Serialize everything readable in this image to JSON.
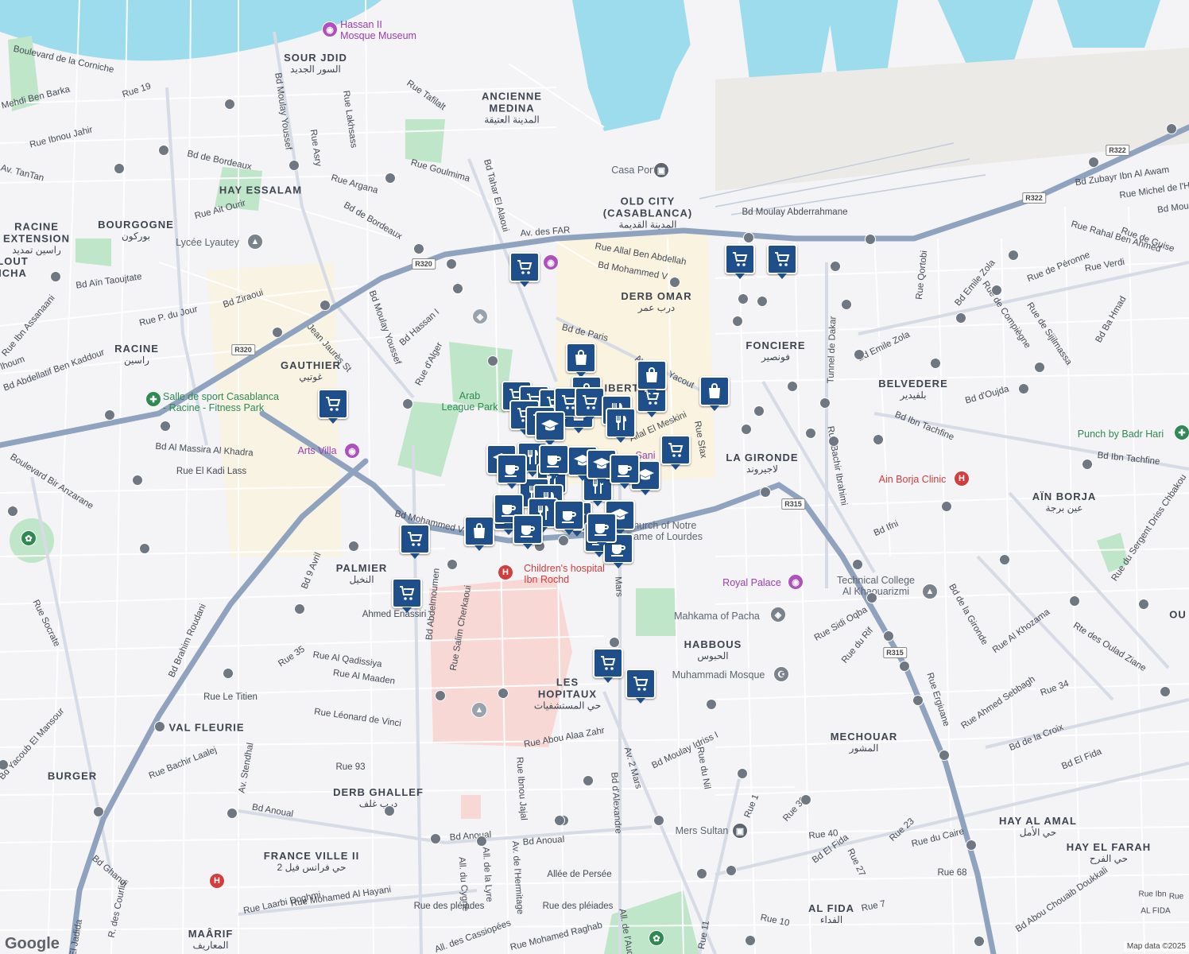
{
  "map": {
    "attribution": "Map data ©2025",
    "logo": "Google",
    "route_shields": [
      "R320",
      "R320",
      "R315",
      "R315",
      "R322",
      "R322"
    ],
    "districts": [
      {
        "name": "SOUR JDID",
        "ar": "السور الجديد"
      },
      {
        "name": "ANCIENNE\nMEDINA",
        "ar": "المدينة العتيقة"
      },
      {
        "name": "OLD CITY\n(CASABLANCA)",
        "ar": "المدينة القديمة"
      },
      {
        "name": "HAY ESSALAM",
        "ar": ""
      },
      {
        "name": "BOURGOGNE",
        "ar": "بوركون"
      },
      {
        "name": "RACINE\nEXTENSION",
        "ar": "راسين تمديد"
      },
      {
        "name": "LOUT\nICHA",
        "ar": ""
      },
      {
        "name": "RACINE",
        "ar": "راسين"
      },
      {
        "name": "GAUTHIER",
        "ar": "غوتيي"
      },
      {
        "name": "DERB OMAR",
        "ar": "درب عمر"
      },
      {
        "name": "FONCIERE",
        "ar": "فونصير"
      },
      {
        "name": "BELVEDERE",
        "ar": "بلفيدير"
      },
      {
        "name": "LIBERT",
        "ar": ""
      },
      {
        "name": "LA GIRONDE",
        "ar": "لاجيروند"
      },
      {
        "name": "AÏN BORJA",
        "ar": "عين برجة"
      },
      {
        "name": "PALMIER",
        "ar": "النخيل"
      },
      {
        "name": "HABBOUS",
        "ar": "الحبوس"
      },
      {
        "name": "LES\nHOPITAUX",
        "ar": "حي المستشفيات"
      },
      {
        "name": "MECHOUAR",
        "ar": "المشور"
      },
      {
        "name": "VAL FLEURIE",
        "ar": ""
      },
      {
        "name": "BURGER",
        "ar": ""
      },
      {
        "name": "DERB GHALLEF",
        "ar": "درب غلف"
      },
      {
        "name": "FRANCE VILLE II",
        "ar": "حي فرانس فيل 2"
      },
      {
        "name": "HAY AL AMAL",
        "ar": "حي الأمل"
      },
      {
        "name": "HAY EL FARAH",
        "ar": "حي الفرح"
      },
      {
        "name": "AL FIDA",
        "ar": "الفداء"
      },
      {
        "name": "MAÂRIF",
        "ar": "المعاريف"
      },
      {
        "name": "OU",
        "ar": ""
      }
    ],
    "streets": [
      "Boulevard de la Corniche",
      "Mehdi Ben Barka",
      "Rue 19",
      "Rue Ibnou Jahir",
      "Bd de Bordeaux",
      "Av. TanTan",
      "Bd Moulay Youssef",
      "Rue Asry",
      "Rue Lakhsass",
      "Rue Tafilalt",
      "Rue Argana",
      "Rue Goulmima",
      "Bd Tahar El Alaoui",
      "Rue Ait Ourir",
      "Bd de Bordeaux",
      "Bd Aïn Taoujtate",
      "Rue P. du Jour",
      "Bd Ziraoui",
      "Rue Ibn Assanaani",
      "Jean Jaurès St",
      "Bd Hassan I",
      "Rue d'Alger",
      "Bd Moulay Youssef",
      "Bd Abdellatif Ben Kaddour",
      "lhoum",
      "Av. des FAR",
      "Rue Allal Ben Abdellah",
      "Bd Mohammed V",
      "Bd de Paris",
      "Av. Lalla Yacout",
      "Bd Moulay Abderrahmane",
      "Tunnel de Dakar",
      "Rue Qortobi",
      "Bd Emile Zola",
      "Rue de Compiègne",
      "Rue de Sijilmassa",
      "Bd Ba Hmad",
      "Rue de Péronne",
      "Rue Verdi",
      "Rue de Guise",
      "Rue Rahal Ben Ahmed",
      "Bd Zubayr Ibn Al Awam",
      "Rue Michel de l'H",
      "Bd Mou",
      "Bd Emile Zola",
      "Bd d'Oujda",
      "Bd Ibn Tachfine",
      "Bd Ibn Tachfine",
      "Rue Bachir Ibrahimi",
      "Rue Sfax",
      "Allal El Meskini",
      "Bd Al Massira Al Khadra",
      "Boulevard Bir Anzarane",
      "Rue El Kadi Lass",
      "Bd Brahim Roudani",
      "Bd Mohammed V",
      "Bd 9 Avril",
      "Rue Socrate",
      "Bd Abdelmoumen",
      "Rue Salim Cherkaoui",
      "Ahmed Enassiri",
      "Bd Ifni",
      "Rue Sidi Oqba",
      "Rue du Rif",
      "Bd de la Gironde",
      "Rue Al Khozama",
      "Rte des Oulad Ziane",
      "Rue du Sergent Driss Chbakou",
      "Rue 35",
      "Rue Al Qadissiya",
      "Rue Al Maaden",
      "Rue Le Titien",
      "Rue Léonard de Vinci",
      "Bd Yacoub El Mansour",
      "Rue Bachir Laalej",
      "Av. Stendhal",
      "Rue 93",
      "Rue Abou Alaa Zahr",
      "Av. 2 Mars",
      "Bd Moulay Idriss I",
      "Rue du Nil",
      "Rue Ergiuane",
      "Rue Ahmed Sebbagh",
      "Rue 34",
      "Bd de la Croix",
      "Bd El Fida",
      "Bd Anoual",
      "Bd Anoual",
      "Bd Anoual",
      "Rue Ibnou Jajal",
      "Av. de l'Hermitage",
      "All. de la Lyre",
      "All. du Cygne",
      "Rue 1",
      "Rue 39",
      "Rue 40",
      "Rue 23",
      "Rue du Caire",
      "Bd El Fida",
      "Rue 27",
      "Rue 68",
      "Rue 7",
      "Rue 10",
      "Bd Abou Chouaib Doukkali",
      "Bd Ghandi",
      "R. des Courlis",
      "Rue Laarbi Doghmi",
      "Rue Mohamed Al Hayani",
      "Rue des pléiades",
      "Rue des pléiades",
      "Allée de Persée",
      "All. des Cassiopées",
      "Rue Mohamed Raghab",
      "All. de l'Aude",
      "Rue 11",
      "Bd d'Alexandre",
      "Mars",
      "El Jadida",
      "AL FIDA",
      "Rue Ibn",
      "Rue"
    ],
    "pois": [
      {
        "label": "Hassan II\nMosque Museum",
        "kind": "museum"
      },
      {
        "label": "Casa Port",
        "kind": "transit"
      },
      {
        "label": "Lycée Lyautey",
        "kind": "school"
      },
      {
        "label": "Arab\nLeague Park",
        "kind": "park"
      },
      {
        "label": "Salle de sport Casablanca\n- Racine - Fitness Park",
        "kind": "gym"
      },
      {
        "label": "Arts Villa",
        "kind": "museum"
      },
      {
        "label": "Children's hospital\nIbn Rochd",
        "kind": "hospital"
      },
      {
        "label": "Church of Notre\nDame of Lourdes",
        "kind": "church"
      },
      {
        "label": "Royal Palace",
        "kind": "museum"
      },
      {
        "label": "Mahkama of Pacha",
        "kind": "landmark"
      },
      {
        "label": "Muhammadi Mosque",
        "kind": "mosque"
      },
      {
        "label": "Technical College\nAl Khaouarizmi",
        "kind": "school"
      },
      {
        "label": "Ain Borja Clinic",
        "kind": "hospital"
      },
      {
        "label": "Punch by Badr Hari",
        "kind": "gym"
      },
      {
        "label": "Mers Sultan",
        "kind": "transit"
      },
      {
        "label": "Sani",
        "kind": "other"
      }
    ],
    "marker_types": [
      "shopping-cart-icon",
      "shopping-bag-icon",
      "coffee-cup-icon",
      "restaurant-icon",
      "graduation-cap-icon"
    ]
  }
}
